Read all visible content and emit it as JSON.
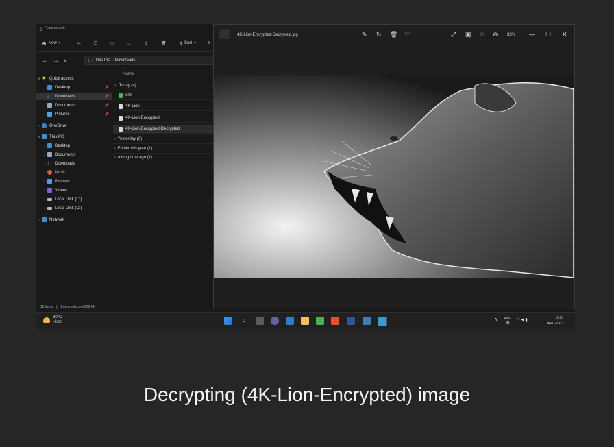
{
  "explorer": {
    "title": "Downloads",
    "toolbar": {
      "new_label": "New",
      "sort_label": "Sort"
    },
    "breadcrumb": {
      "root": "This PC",
      "current": "Downloads"
    },
    "sidebar": [
      {
        "label": "Quick access",
        "level": 0,
        "icon": "star-icon"
      },
      {
        "label": "Desktop",
        "level": 1,
        "icon": "desktop-folder-icon",
        "pinned": true
      },
      {
        "label": "Downloads",
        "level": 1,
        "icon": "download-folder-icon",
        "pinned": true,
        "selected": true
      },
      {
        "label": "Documents",
        "level": 1,
        "icon": "documents-folder-icon",
        "pinned": true
      },
      {
        "label": "Pictures",
        "level": 1,
        "icon": "pictures-folder-icon",
        "pinned": true
      },
      {
        "label": "OneDrive",
        "level": 0,
        "icon": "cloud-icon"
      },
      {
        "label": "This PC",
        "level": 0,
        "icon": "computer-icon"
      },
      {
        "label": "Desktop",
        "level": 1,
        "icon": "desktop-folder-icon"
      },
      {
        "label": "Documents",
        "level": 1,
        "icon": "documents-folder-icon"
      },
      {
        "label": "Downloads",
        "level": 1,
        "icon": "download-folder-icon"
      },
      {
        "label": "Music",
        "level": 1,
        "icon": "music-folder-icon"
      },
      {
        "label": "Pictures",
        "level": 1,
        "icon": "pictures-folder-icon"
      },
      {
        "label": "Videos",
        "level": 1,
        "icon": "videos-folder-icon"
      },
      {
        "label": "Local Disk (C:)",
        "level": 1,
        "icon": "drive-icon"
      },
      {
        "label": "Local Disk (D:)",
        "level": 1,
        "icon": "drive-icon"
      },
      {
        "label": "Network",
        "level": 0,
        "icon": "network-icon"
      }
    ],
    "column_name": "Name",
    "groups": {
      "today": "Today (4)",
      "yesterday": "Yesterday (6)",
      "earlier": "Earlier this year (1)",
      "long_ago": "A long time ago (1)"
    },
    "files": [
      "one",
      "4K-Lion",
      "4K-Lion-Encrypted",
      "4K-Lion-Encrypted-Decrypted"
    ],
    "status": {
      "items": "12 items",
      "selected": "1 item selected  608 KB"
    }
  },
  "photos": {
    "filename": "4K-Lion-Encrypted-Decrypted.jpg",
    "zoom": "33%"
  },
  "taskbar": {
    "weather_temp": "30°C",
    "weather_desc": "Haze",
    "lang": "ENG",
    "region": "IN",
    "time": "15:51",
    "date": "14-07-2022"
  },
  "caption": "Decrypting (4K-Lion-Encrypted) image"
}
